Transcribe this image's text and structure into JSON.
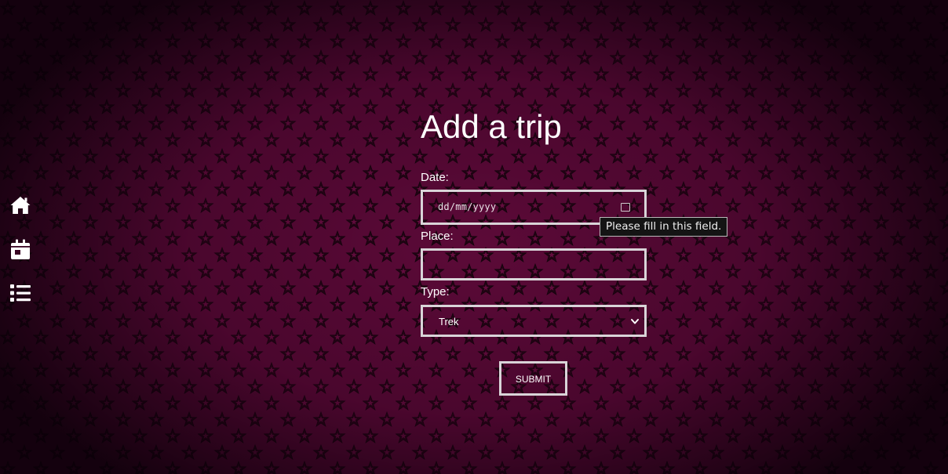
{
  "page": {
    "title": "Add a trip",
    "background_color": "#3a0524",
    "accent_color": "#8a0f52"
  },
  "sidebar": {
    "items": [
      {
        "icon": "home-icon"
      },
      {
        "icon": "calendar-icon"
      },
      {
        "icon": "list-icon"
      }
    ]
  },
  "form": {
    "date": {
      "label": "Date:",
      "placeholder": "dd/mm/yyyy",
      "value": ""
    },
    "place": {
      "label": "Place:",
      "value": ""
    },
    "type": {
      "label": "Type:",
      "selected": "Trek"
    },
    "submit_label": "SUBMIT"
  },
  "tooltip": {
    "text": "Please fill in this field."
  }
}
